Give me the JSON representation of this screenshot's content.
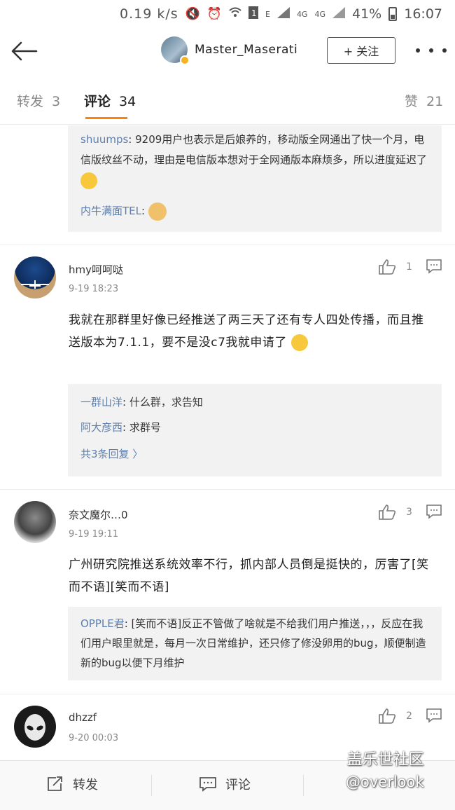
{
  "status_bar": {
    "speed": "0.19 k/s",
    "network_a": "E",
    "network_b": "4G",
    "network_c": "4G",
    "battery": "41%",
    "time": "16:07"
  },
  "header": {
    "username": "Master_Maserati",
    "follow_label": "+ 关注"
  },
  "tabs": [
    {
      "label": "转发",
      "count": "3"
    },
    {
      "label": "评论",
      "count": "34"
    },
    {
      "label": "赞",
      "count": "21"
    }
  ],
  "comments": [
    {
      "replies": [
        {
          "name": "shuumps",
          "text": ": 9209用户也表示是后娘养的，移动版全网通出了快一个月，电信版纹丝不动，理由是电信版本想对于全网通版本麻烦多，所以进度延迟了"
        },
        {
          "name": "内牛满面TEL",
          "text": ":"
        }
      ]
    },
    {
      "name": "hmy呵呵哒",
      "time": "9-19 18:23",
      "likes": "1",
      "text": "我就在那群里好像已经推送了两三天了还有专人四处传播，而且推送版本为7.1.1，要不是没c7我就申请了",
      "replies": [
        {
          "name": "一群山洋",
          "text": ": 什么群，求告知"
        },
        {
          "name": "阿大彦西",
          "text": ": 求群号"
        }
      ],
      "more_replies": "共3条回复 〉"
    },
    {
      "name": "奈文魔尔…0",
      "time": "9-19 19:11",
      "likes": "3",
      "text": "广州研究院推送系统效率不行，抓内部人员倒是挺快的，厉害了[笑而不语][笑而不语]",
      "replies": [
        {
          "name": "OPPLE君",
          "text": ": [笑而不语]反正不管做了啥就是不给我们用户推送，，，反应在我们用户眼里就是，每月一次日常维护，还只修了修没卵用的bug，顺便制造新的bug以便下月维护"
        }
      ]
    },
    {
      "name": "dhzzf",
      "time": "9-20 00:03",
      "likes": "2"
    }
  ],
  "bottom_bar": {
    "repost": "转发",
    "comment": "评论"
  },
  "watermark": {
    "line1": "盖乐世社区",
    "line2": "@overlook"
  }
}
